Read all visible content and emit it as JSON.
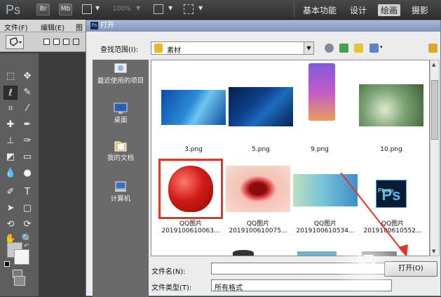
{
  "topbar": {
    "app_logo": "Ps",
    "btn_br": "Br",
    "btn_mb": "Mb",
    "zoom": "100%",
    "workspaces": [
      "基本功能",
      "设计",
      "绘画",
      "摄影"
    ],
    "active_workspace": "绘画"
  },
  "menu": {
    "items": [
      "文件(F)",
      "编辑(E)",
      "图"
    ]
  },
  "dialog": {
    "title": "打开",
    "title_icon": "Ps",
    "look_in_label": "查找范围(I):",
    "look_in_value": "素材",
    "places": [
      "最近使用的项目",
      "桌面",
      "我的文档",
      "计算机"
    ],
    "files": [
      {
        "name": "3.png"
      },
      {
        "name": "5.png"
      },
      {
        "name": "9.png"
      },
      {
        "name": "10.png"
      },
      {
        "name": "QQ图片",
        "sub": "2019100610063..."
      },
      {
        "name": "QQ图片",
        "sub": "2019100610075..."
      },
      {
        "name": "QQ图片",
        "sub": "2019100610534..."
      },
      {
        "name": "QQ图片",
        "sub": "2019100610552..."
      }
    ],
    "ps_thumb_label": "Photo",
    "filename_label": "文件名(N):",
    "filename_value": "",
    "filetype_label": "文件类型(T):",
    "filetype_value": "所有格式",
    "open_button": "打开(O)"
  },
  "watermark": "经",
  "colors": {
    "selection_highlight": "#d63a2c",
    "annotation_arrow": "#e8332a",
    "title_bar": "#8ea2c7"
  }
}
